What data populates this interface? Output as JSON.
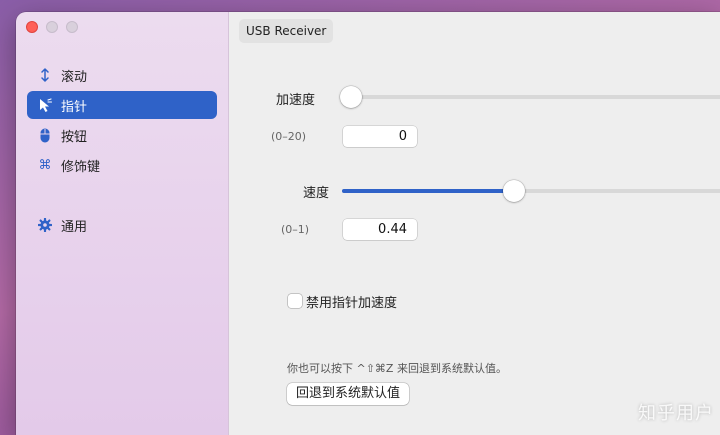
{
  "sidebar": {
    "items": [
      {
        "label": "滚动",
        "icon": "updown-arrow-icon",
        "active": false
      },
      {
        "label": "指针",
        "icon": "cursor-icon",
        "active": true
      },
      {
        "label": "按钮",
        "icon": "mouse-icon",
        "active": false
      },
      {
        "label": "修饰键",
        "icon": "command-icon",
        "active": false
      }
    ],
    "general": {
      "label": "通用",
      "icon": "gear-icon"
    }
  },
  "device_tab": "USB Receiver",
  "acceleration": {
    "label": "加速度",
    "range": "(0–20)",
    "value": "0",
    "level": 0
  },
  "speed": {
    "label": "速度",
    "range": "(0–1)",
    "value": "0.44",
    "level": 0.44
  },
  "disable_accel": {
    "label": "禁用指针加速度",
    "checked": false
  },
  "reset": {
    "hint": "你也可以按下 ^⇧⌘Z 来回退到系统默认值。",
    "button_label": "回退到系统默认值"
  },
  "watermark": "知乎用户",
  "colors": {
    "accent": "#2f62c8",
    "close": "#ff5f57"
  }
}
